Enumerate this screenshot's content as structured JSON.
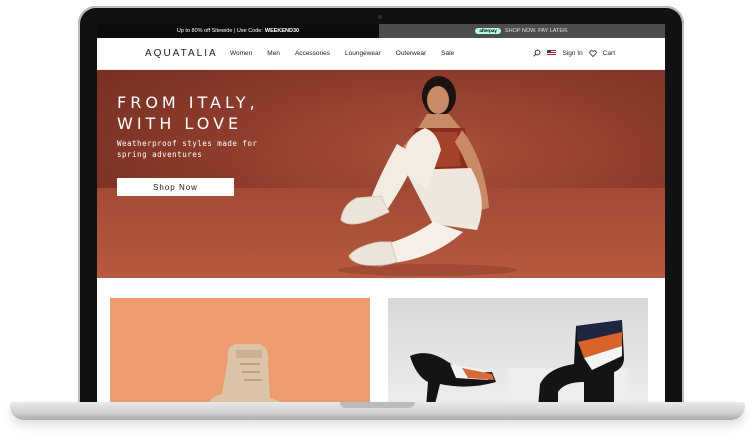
{
  "promo": {
    "left_text": "Up to 80% off Sitewide | Use Code:",
    "left_code": "WEEKEND30",
    "afterpay_badge": "afterpay",
    "right_text": "SHOP NOW. PAY LATER."
  },
  "nav": {
    "logo": "AQUATALIA",
    "links": [
      "Women",
      "Men",
      "Accessories",
      "Loungewear",
      "Outerwear",
      "Sale"
    ],
    "sign_in": "Sign In",
    "cart": "Cart"
  },
  "hero": {
    "title": "FROM ITALY,\nWITH LOVE",
    "subtitle": "Weatherproof styles made for spring adventures",
    "cta": "Shop Now"
  },
  "colors": {
    "hero_bg": "#8d3c2b",
    "tile_left_bg": "#ee9b6f",
    "tile_right_bg": "#dcdcdc",
    "afterpay_green": "#b2fce4"
  },
  "icons": [
    "search-icon",
    "us-flag-icon",
    "heart-icon"
  ]
}
